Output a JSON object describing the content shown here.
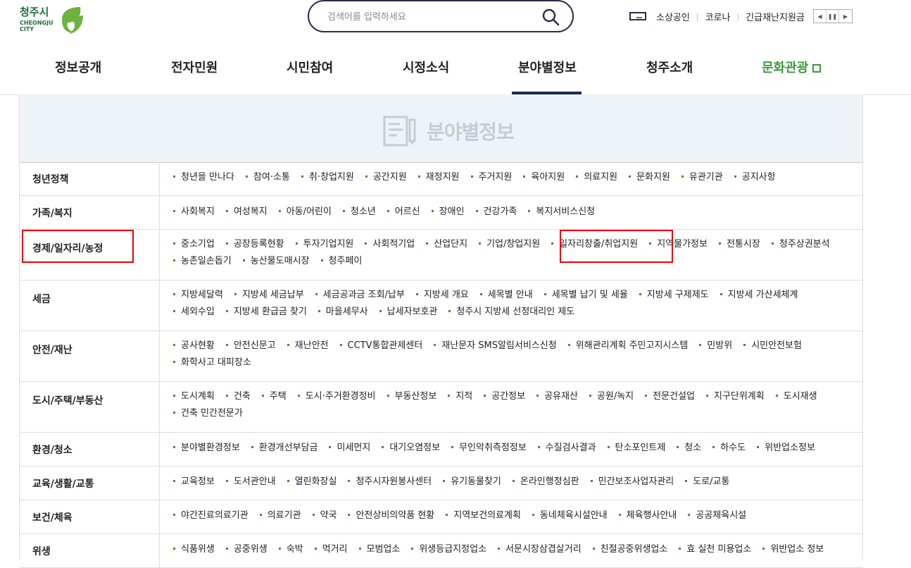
{
  "logo": {
    "name": "청주시",
    "sub1": "CHEONGJU",
    "sub2": "CITY"
  },
  "search": {
    "placeholder": "검색어를 입력하세요"
  },
  "util": {
    "links": [
      "소상공인",
      "코로나",
      "긴급재난지원금"
    ]
  },
  "gnb": [
    "정보공개",
    "전자민원",
    "시민참여",
    "시정소식",
    "분야별정보",
    "청주소개",
    "문화관광"
  ],
  "banner": {
    "title": "분야별정보"
  },
  "rows": [
    {
      "cat": "청년정책",
      "links": [
        "청년을 만나다",
        "참여·소통",
        "취·창업지원",
        "공간지원",
        "재정지원",
        "주거지원",
        "육아지원",
        "의료지원",
        "문화지원",
        "유관기관",
        "공지사항"
      ]
    },
    {
      "cat": "가족/복지",
      "links": [
        "사회복지",
        "여성복지",
        "아동/어린이",
        "청소년",
        "어르신",
        "장애인",
        "건강가족",
        "복지서비스신청"
      ]
    },
    {
      "cat": "경제/일자리/농정",
      "links": [
        "중소기업",
        "공장등록현황",
        "투자기업지원",
        "사회적기업",
        "산업단지",
        "기업/창업지원",
        "일자리창출/취업지원",
        "지역물가정보",
        "전통시장",
        "청주상권분석",
        "농촌일손돕기",
        "농산물도매시장",
        "청주페이"
      ]
    },
    {
      "cat": "세금",
      "links": [
        "지방세달력",
        "지방세 세금납부",
        "세금공과금 조회/납부",
        "지방세 개요",
        "세목별 안내",
        "세목별 납기 및 세율",
        "지방세 구제제도",
        "지방세 가산세체계",
        "세외수입",
        "지방세 환급금 찾기",
        "마을세무사",
        "납세자보호관",
        "청주시 지방세 선정대리인 제도"
      ]
    },
    {
      "cat": "안전/재난",
      "links": [
        "공사현황",
        "안전신문고",
        "재난안전",
        "CCTV통합관제센터",
        "재난문자 SMS알림서비스신청",
        "위해관리계획 주민고지시스템",
        "민방위",
        "시민안전보험",
        "화학사고 대피장소"
      ]
    },
    {
      "cat": "도시/주택/부동산",
      "links": [
        "도시계획",
        "건축",
        "주택",
        "도시·주거환경정비",
        "부동산정보",
        "지적",
        "공간정보",
        "공유재산",
        "공원/녹지",
        "전문건설업",
        "지구단위계획",
        "도시재생",
        "건축 민간전문가"
      ]
    },
    {
      "cat": "환경/청소",
      "links": [
        "분야별환경정보",
        "환경개선부담금",
        "미세먼지",
        "대기오염정보",
        "무인악취측정정보",
        "수질검사결과",
        "탄소포인트제",
        "청소",
        "하수도",
        "위반업소정보"
      ]
    },
    {
      "cat": "교육/생활/교통",
      "links": [
        "교육정보",
        "도서관안내",
        "열린화장실",
        "청주시자원봉사센터",
        "유기동물찾기",
        "온라인행정심판",
        "민간보조사업자관리",
        "도로/교통"
      ]
    },
    {
      "cat": "보건/체육",
      "links": [
        "야간진료의료기관",
        "의료기관",
        "약국",
        "안전상비의약품 현황",
        "지역보건의료계획",
        "동네체육시설안내",
        "체육행사안내",
        "공공체육시설"
      ]
    },
    {
      "cat": "위생",
      "links": [
        "식품위생",
        "공중위생",
        "숙박",
        "먹거리",
        "모범업소",
        "위생등급지정업소",
        "서문시장삼겹살거리",
        "친절공중위생업소",
        "효 실천 미용업소",
        "위반업소 정보"
      ]
    }
  ],
  "colors": {
    "accent_green": "#4a8c2a",
    "highlight_red": "#e00000",
    "navy": "#1f2a4a"
  }
}
